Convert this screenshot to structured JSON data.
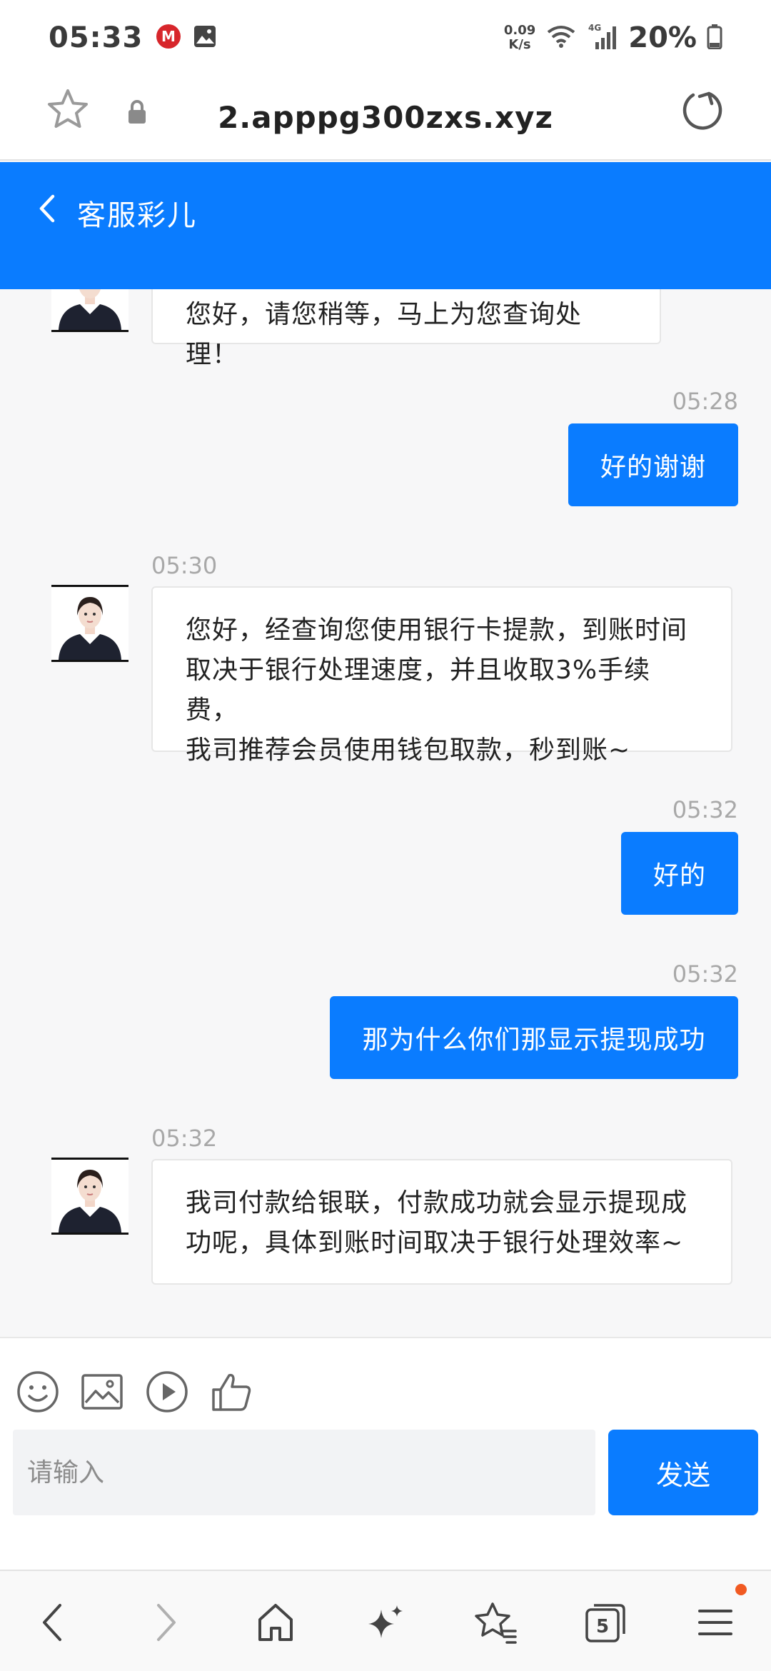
{
  "status_bar": {
    "time": "05:33",
    "net_speed_value": "0.09",
    "net_speed_unit": "K/s",
    "network_type": "4G",
    "battery": "20%"
  },
  "browser": {
    "url": "2.apppg300zxs.xyz"
  },
  "chat": {
    "title": "客服彩儿",
    "messages": [
      {
        "direction": "in",
        "time": "",
        "text": "您好，请您稍等，马上为您查询处理！"
      },
      {
        "direction": "out",
        "time": "05:28",
        "text": "好的谢谢"
      },
      {
        "direction": "in",
        "time": "05:30",
        "lines": [
          "您好，经查询您使用银行卡提款，到账时间",
          "取决于银行处理速度，并且收取3%手续费，",
          "我司推荐会员使用钱包取款，秒到账~"
        ]
      },
      {
        "direction": "out",
        "time": "05:32",
        "text": "好的"
      },
      {
        "direction": "out",
        "time": "05:32",
        "text": "那为什么你们那显示提现成功"
      },
      {
        "direction": "in",
        "time": "05:32",
        "lines": [
          "我司付款给银联，付款成功就会显示提现成",
          "功呢，具体到账时间取决于银行处理效率~"
        ]
      }
    ]
  },
  "composer": {
    "placeholder": "请输入",
    "send_label": "发送"
  },
  "bottom_nav": {
    "tabs_count": "5"
  },
  "colors": {
    "accent": "#0a7cff",
    "notification_dot": "#f15a22"
  }
}
